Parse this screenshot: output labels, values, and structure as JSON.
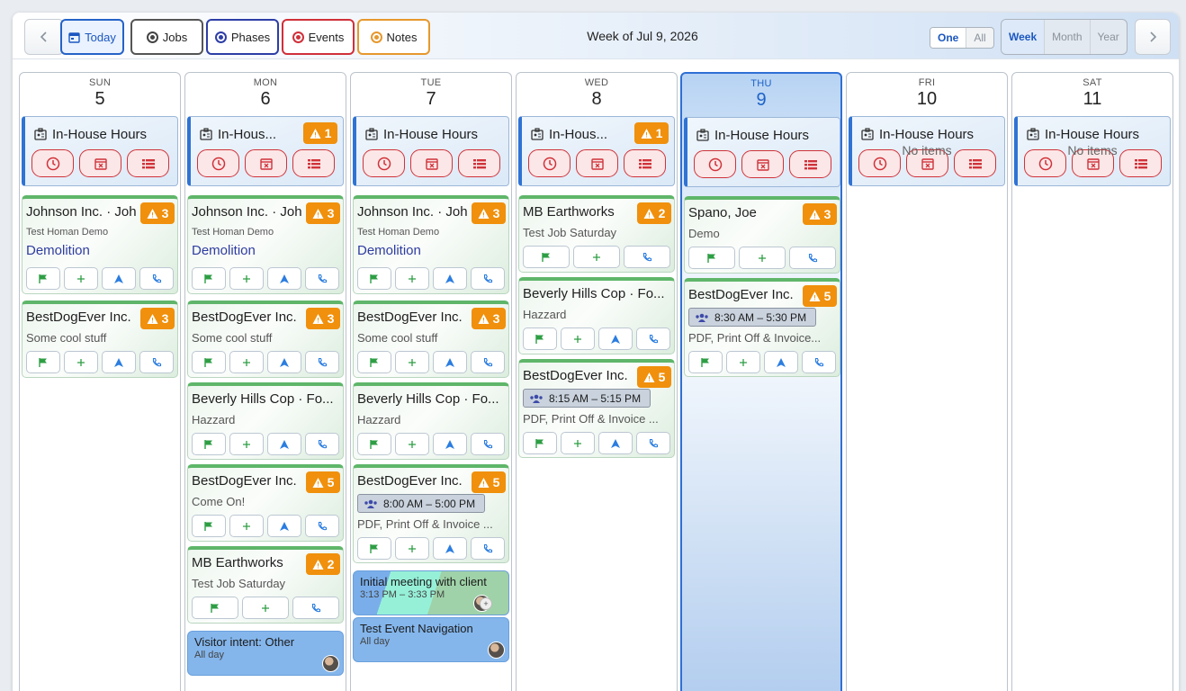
{
  "toolbar": {
    "prev_icon": "chevron-left-icon",
    "today_label": "Today",
    "jobs_label": "Jobs",
    "phases_label": "Phases",
    "events_label": "Events",
    "notes_label": "Notes",
    "week_title": "Week of Jul 9, 2026",
    "scope_options": [
      "One",
      "All"
    ],
    "scope_selected": "One",
    "view_options": [
      "Week",
      "Month",
      "Year"
    ],
    "view_selected": "Week",
    "next_icon": "chevron-right-icon",
    "colors": {
      "today": "#2563c8",
      "jobs": "#555555",
      "phases": "#2d3ea6",
      "events": "#d0303a",
      "notes": "#e6982d"
    }
  },
  "days": [
    {
      "name": "SUN",
      "num": "5"
    },
    {
      "name": "MON",
      "num": "6"
    },
    {
      "name": "TUE",
      "num": "7"
    },
    {
      "name": "WED",
      "num": "8"
    },
    {
      "name": "THU",
      "num": "9"
    },
    {
      "name": "FRI",
      "num": "10",
      "empty": "No items"
    },
    {
      "name": "SAT",
      "num": "11",
      "empty": "No items"
    }
  ],
  "inhouse": {
    "label": "In-House Hours",
    "label_short": "In-Hous...",
    "label_short_wed": "In-Hous...",
    "badge": "1",
    "actions": [
      "clock-icon",
      "calendar-x-icon",
      "list-icon"
    ]
  },
  "cards": {
    "johnson": {
      "title": "Johnson Inc. · Joh",
      "sub": "Test Homan Demo",
      "phase": "Demolition",
      "badge": "3"
    },
    "bestdog_cool": {
      "title": "BestDogEver Inc.",
      "sub": "Some cool stuff",
      "badge": "3"
    },
    "beverly": {
      "title": "Beverly Hills Cop · Fo...",
      "sub": "Hazzard"
    },
    "bestdog_comeon": {
      "title": "BestDogEver Inc.",
      "sub": "Come On!",
      "badge": "5"
    },
    "mb": {
      "title": "MB Earthworks",
      "sub": "Test Job Saturday",
      "badge": "2"
    },
    "bestdog_pdf_tue": {
      "title": "BestDogEver Inc.",
      "time": "8:00 AM – 5:00 PM",
      "sub": "PDF, Print Off & Invoice ...",
      "badge": "5"
    },
    "bestdog_pdf_wed": {
      "title": "BestDogEver Inc.",
      "time": "8:15 AM – 5:15 PM",
      "sub": "PDF, Print Off & Invoice ...",
      "badge": "5"
    },
    "bestdog_pdf_thu": {
      "title": "BestDogEver Inc.",
      "time": "8:30 AM – 5:30 PM",
      "sub": "PDF, Print Off & Invoice...",
      "badge": "5"
    },
    "spano": {
      "title": "Spano, Joe",
      "sub": "Demo",
      "badge": "3"
    }
  },
  "events": {
    "visitor": {
      "title": "Visitor intent: Other",
      "time": "All day"
    },
    "meeting": {
      "title": "Initial meeting with client",
      "time": "3:13 PM – 3:33 PM"
    },
    "nav": {
      "title": "Test Event Navigation",
      "time": "All day"
    }
  }
}
